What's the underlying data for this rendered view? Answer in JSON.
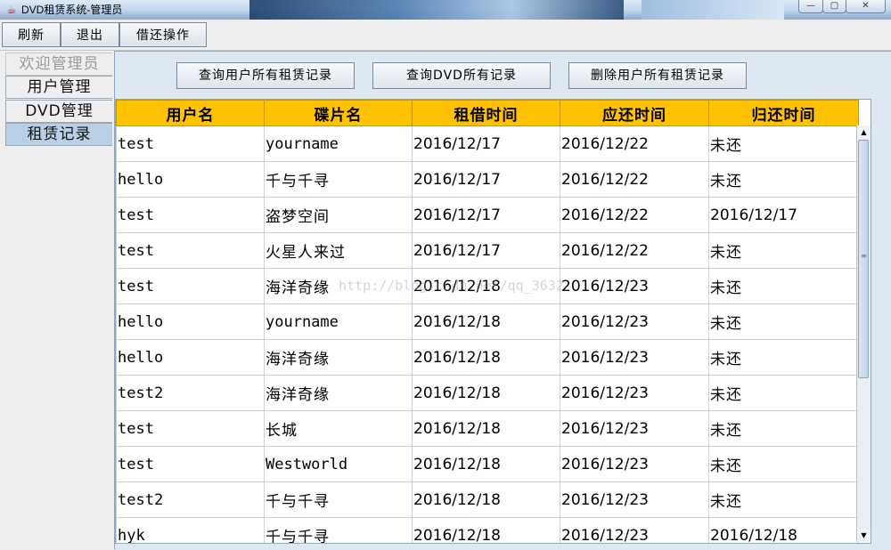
{
  "window": {
    "title": "DVD租赁系统-管理员",
    "controls": {
      "minimize": "—",
      "maximize": "▢",
      "close": "✕"
    }
  },
  "menubar": {
    "refresh": "刷新",
    "exit": "退出",
    "borrow_return": "借还操作"
  },
  "sidebar": {
    "items": [
      {
        "label": "欢迎管理员",
        "state": "disabled"
      },
      {
        "label": "用户管理",
        "state": "normal"
      },
      {
        "label": "DVD管理",
        "state": "normal"
      },
      {
        "label": "租赁记录",
        "state": "active"
      }
    ]
  },
  "actions": {
    "query_user_records": "查询用户所有租赁记录",
    "query_dvd_records": "查询DVD所有记录",
    "delete_user_records": "删除用户所有租赁记录"
  },
  "table": {
    "headers": [
      "用户名",
      "碟片名",
      "租借时间",
      "应还时间",
      "归还时间"
    ],
    "rows": [
      [
        "test",
        "yourname",
        "2016/12/17",
        "2016/12/22",
        "未还"
      ],
      [
        "hello",
        "千与千寻",
        "2016/12/17",
        "2016/12/22",
        "未还"
      ],
      [
        "test",
        "盗梦空间",
        "2016/12/17",
        "2016/12/22",
        "2016/12/17"
      ],
      [
        "test",
        "火星人来过",
        "2016/12/17",
        "2016/12/22",
        "未还"
      ],
      [
        "test",
        "海洋奇缘",
        "2016/12/18",
        "2016/12/23",
        "未还"
      ],
      [
        "hello",
        "yourname",
        "2016/12/18",
        "2016/12/23",
        "未还"
      ],
      [
        "hello",
        "海洋奇缘",
        "2016/12/18",
        "2016/12/23",
        "未还"
      ],
      [
        "test2",
        "海洋奇缘",
        "2016/12/18",
        "2016/12/23",
        "未还"
      ],
      [
        "test",
        "长城",
        "2016/12/18",
        "2016/12/23",
        "未还"
      ],
      [
        "test",
        "Westworld",
        "2016/12/18",
        "2016/12/23",
        "未还"
      ],
      [
        "test2",
        "千与千寻",
        "2016/12/18",
        "2016/12/23",
        "未还"
      ],
      [
        "hyk",
        "千与千寻",
        "2016/12/18",
        "2016/12/23",
        "2016/12/18"
      ]
    ]
  },
  "watermark": "http://blog.csdn.net/qq_3632",
  "colors": {
    "header_bg": "#ffc200",
    "active_sidebar": "#b8cfe5"
  }
}
